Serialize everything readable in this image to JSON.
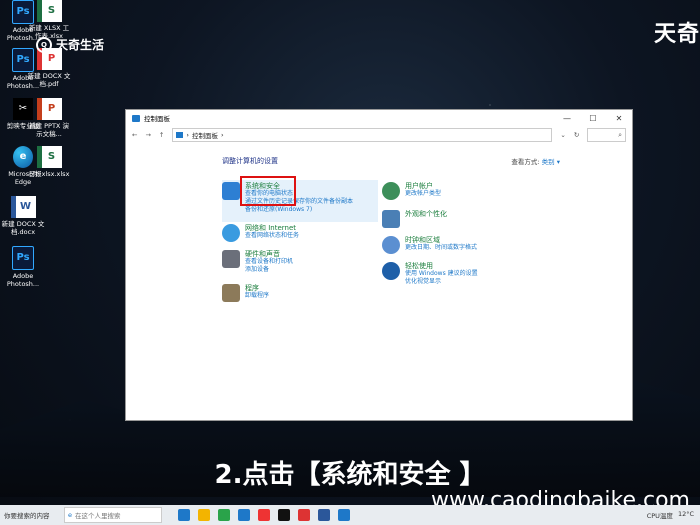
{
  "desktop": {
    "icons": [
      {
        "label": "Adobe Photosh...",
        "glyph": "Ps",
        "kind": "ps"
      },
      {
        "label": "新建 XLSX 工作表.xlsx",
        "glyph": "S",
        "kind": "xlsx"
      },
      {
        "label": "Adobe Photosh...",
        "glyph": "Ps",
        "kind": "ps"
      },
      {
        "label": "新建 DOCX 文档.pdf",
        "glyph": "P",
        "kind": "pdf"
      },
      {
        "label": "剪映专业版",
        "glyph": "✂",
        "kind": "capcut"
      },
      {
        "label": "新建 PPTX 演示文稿...",
        "glyph": "P",
        "kind": "pptx"
      },
      {
        "label": "Microsoft Edge",
        "glyph": "e",
        "kind": "edge"
      },
      {
        "label": "日报xlsx.xlsx",
        "glyph": "S",
        "kind": "xlsx"
      },
      {
        "label": "新建 DOCX 文档.docx",
        "glyph": "W",
        "kind": "docx"
      },
      {
        "label": "Adobe Photosh...",
        "glyph": "Ps",
        "kind": "ps"
      }
    ]
  },
  "watermark": {
    "brand_left": "天奇生活",
    "brand_right": "天奇",
    "site": "www.caodingbaike.com"
  },
  "window": {
    "title": "控制面板",
    "controls": [
      "—",
      "☐",
      "✕"
    ],
    "address": "控制面板",
    "heading": "调整计算机的设置",
    "view_by_label": "查看方式:",
    "view_by_value": "类别 ▾",
    "categories": [
      {
        "title": "系统和安全",
        "subs": [
          "查看你的电脑状态",
          "通过文件历史记录保存你的文件备份副本",
          "备份和还原(Windows 7)"
        ],
        "icon_color": "#2d7fd3"
      },
      {
        "title": "网络和 Internet",
        "subs": [
          "查看网络状态和任务"
        ],
        "icon_color": "#3a9be0"
      },
      {
        "title": "硬件和声音",
        "subs": [
          "查看设备和打印机",
          "添加设备"
        ],
        "icon_color": "#6b6f7a"
      },
      {
        "title": "程序",
        "subs": [
          "卸载程序"
        ],
        "icon_color": "#8c7a5a"
      },
      {
        "title": "用户帐户",
        "subs": [
          "更改帐户类型"
        ],
        "icon_color": "#3d8f5a"
      },
      {
        "title": "外观和个性化",
        "subs": [],
        "icon_color": "#4a7fb5"
      },
      {
        "title": "时钟和区域",
        "subs": [
          "更改日期、时间或数字格式"
        ],
        "icon_color": "#5b8fd1"
      },
      {
        "title": "轻松使用",
        "subs": [
          "使用 Windows 建议的设置",
          "优化视觉显示"
        ],
        "icon_color": "#1e5fa8"
      }
    ]
  },
  "caption": "2.点击【系统和安全 】",
  "taskbar": {
    "search_text": "你要搜索的内容",
    "edge_search": "在这个人里搜索",
    "apps": [
      "#1e78c8",
      "#f3b400",
      "#2aa34a",
      "#1e78c8",
      "#e33",
      "#111",
      "#d33",
      "#2b579a",
      "#1e78c8"
    ],
    "tray_weather": "CPU温度",
    "tray_temp": "12°C"
  }
}
